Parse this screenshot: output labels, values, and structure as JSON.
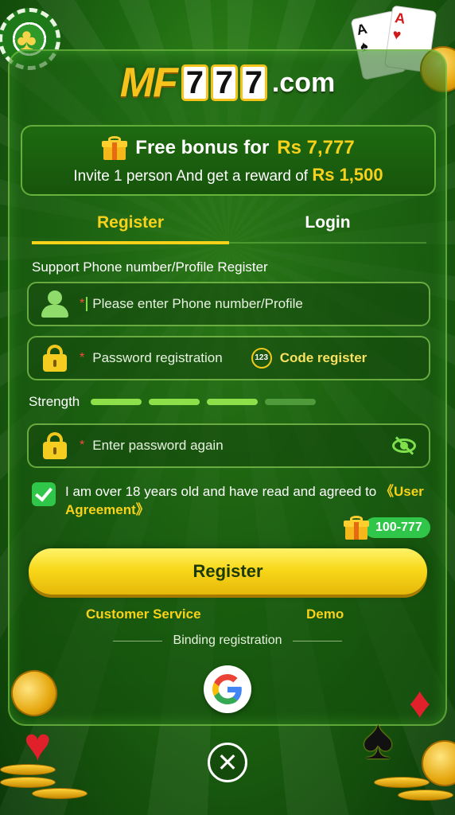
{
  "logo": {
    "mf": "MF",
    "digits": [
      "7",
      "7",
      "7"
    ],
    "suffix": ".com"
  },
  "bonus": {
    "line1_prefix": "Free bonus for",
    "line1_amount": "Rs 7,777",
    "line2_prefix": "Invite 1 person And get a reward of",
    "line2_amount": "Rs 1,500",
    "icon": "gift-icon"
  },
  "tabs": [
    {
      "label": "Register",
      "active": true
    },
    {
      "label": "Login",
      "active": false
    }
  ],
  "form": {
    "support_label": "Support Phone number/Profile Register",
    "required_mark": "*",
    "phone": {
      "placeholder": "Please enter Phone number/Profile",
      "icon": "user-icon"
    },
    "password": {
      "placeholder": "Password registration",
      "icon": "lock-icon"
    },
    "code_register": {
      "badge": "123",
      "label": "Code register"
    },
    "strength": {
      "label": "Strength",
      "segments": [
        {
          "color": "#8ee04a"
        },
        {
          "color": "#8ee04a"
        },
        {
          "color": "#8ee04a"
        },
        {
          "color": "#4f9a3a"
        }
      ]
    },
    "password_again": {
      "placeholder": "Enter password again",
      "icon": "lock-icon",
      "toggle_icon": "eye-off-icon"
    },
    "agreement": {
      "text": "I am over 18 years old and have read and agreed to ",
      "link": "《User Agreement》",
      "checked": true
    }
  },
  "promo": {
    "label": "100-777",
    "icon": "gift-icon"
  },
  "register_button": "Register",
  "links": {
    "customer_service": "Customer Service",
    "demo": "Demo"
  },
  "binding_label": "Binding registration",
  "colors": {
    "accent_yellow": "#f8d21a",
    "accent_green": "#2fc64a",
    "background": "#1f6a12"
  }
}
